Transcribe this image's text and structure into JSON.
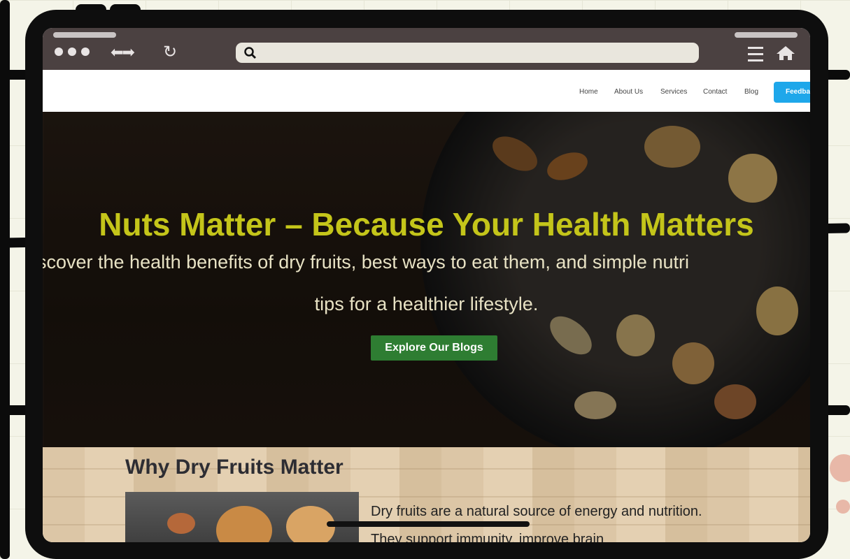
{
  "browser": {
    "icons": [
      "dots-icon",
      "back-forward-icon",
      "reload-icon",
      "search-icon",
      "menu-icon",
      "home-icon"
    ],
    "url": ""
  },
  "nav": {
    "links": [
      "Home",
      "About Us",
      "Services",
      "Contact",
      "Blog"
    ],
    "button": "Feedba"
  },
  "hero": {
    "title": "Nuts Matter – Because Your Health Matters",
    "subtitle_line1": "scover the health benefits of dry fruits, best ways to eat them, and simple nutri",
    "subtitle_line2": "tips for a healthier lifestyle.",
    "cta": "Explore Our Blogs",
    "title_color": "#c4c51a",
    "cta_color": "#2e7d32"
  },
  "why": {
    "heading": "Why Dry Fruits Matter",
    "paragraph": "Dry fruits are a natural source of energy and nutrition. They support immunity, improve brain"
  },
  "colors": {
    "accent": "#1ea7ea",
    "chrome": "#4b4141"
  }
}
